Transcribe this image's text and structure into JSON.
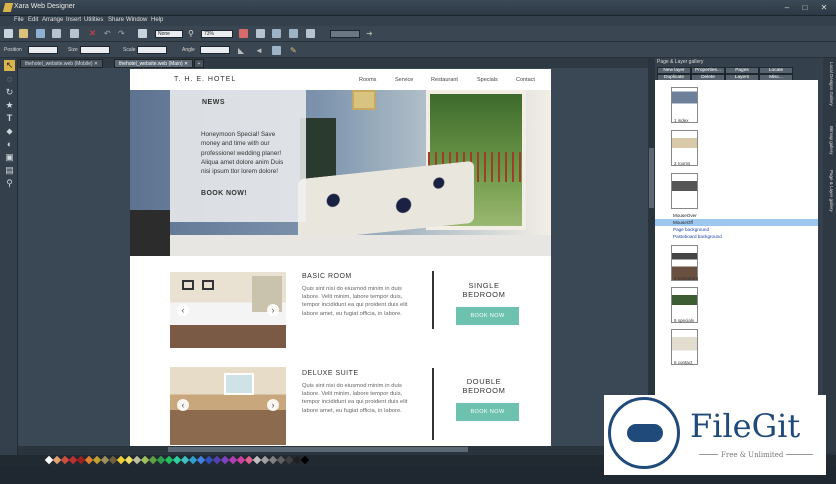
{
  "app": {
    "title": "Xara Web Designer"
  },
  "menu": [
    "File",
    "Edit",
    "Arrange",
    "Insert",
    "Utilities",
    "Share",
    "Window",
    "Help"
  ],
  "toolbar": {
    "blend_mode": "None",
    "zoom": "73%"
  },
  "infobar": {
    "position_label": "Position",
    "size_label": "Size",
    "scale_label": "Scale",
    "angle_label": "Angle"
  },
  "tabs": [
    "thehotel_website.web (Mobile)",
    "thehotel_website.web (Main)"
  ],
  "site": {
    "brand": "T. H. E. HOTEL",
    "nav": [
      "Rooms",
      "Service",
      "Restaurant",
      "Specials",
      "Contact"
    ],
    "hero": {
      "title": "NEWS",
      "text": "Honeymoon Special! Save money and time with our professionel wedding planer! Aliqua amet dolore anim Duis nisi ipsum tlor lorem dolore!",
      "button": "BOOK NOW!"
    },
    "rooms": [
      {
        "title": "BASIC ROOM",
        "text": "Quis sint nisi do eiusmod minim in duis labore. Velit minim, labore tempor duis, tempor incididunt ea qui proident duis elit labore amet, eu fugiat officia, in labore.",
        "name_line1": "SINGLE",
        "name_line2": "BEDROOM",
        "button": "BOOK NOW"
      },
      {
        "title": "DELUXE SUITE",
        "text": "Quis sint nisi do eiusmod minim in duis labore. Velit minim, labore tempor duis, tempor incididunt ea qui proident duis elit labore amet, eu fugiat officia, in labore.",
        "name_line1": "DOUBLE",
        "name_line2": "BEDROOM",
        "button": "BOOK NOW"
      }
    ]
  },
  "gallery": {
    "title": "Page & Layer gallery",
    "buttons": [
      "New layer",
      "Properties...",
      "Pages",
      "Locate",
      "Duplicate",
      "Delete",
      "Layers",
      "Misc..."
    ],
    "pages": [
      "1 index",
      "2 rooms",
      "",
      "4 restaurant",
      "5 specials",
      "6 contact"
    ],
    "layers": [
      "MouseOver",
      "MouseOff",
      "Page background",
      "Pasteboard background"
    ]
  },
  "side_tabs": [
    "Local Designs Gallery",
    "Bitmap gallery",
    "Page & Layer gallery"
  ],
  "watermark": {
    "name": "FileGit",
    "tagline": "Free & Unlimited"
  },
  "colors": {
    "accent": "#6cc2ae",
    "chrome": "#34404b",
    "selection": "#9cc7ee"
  }
}
